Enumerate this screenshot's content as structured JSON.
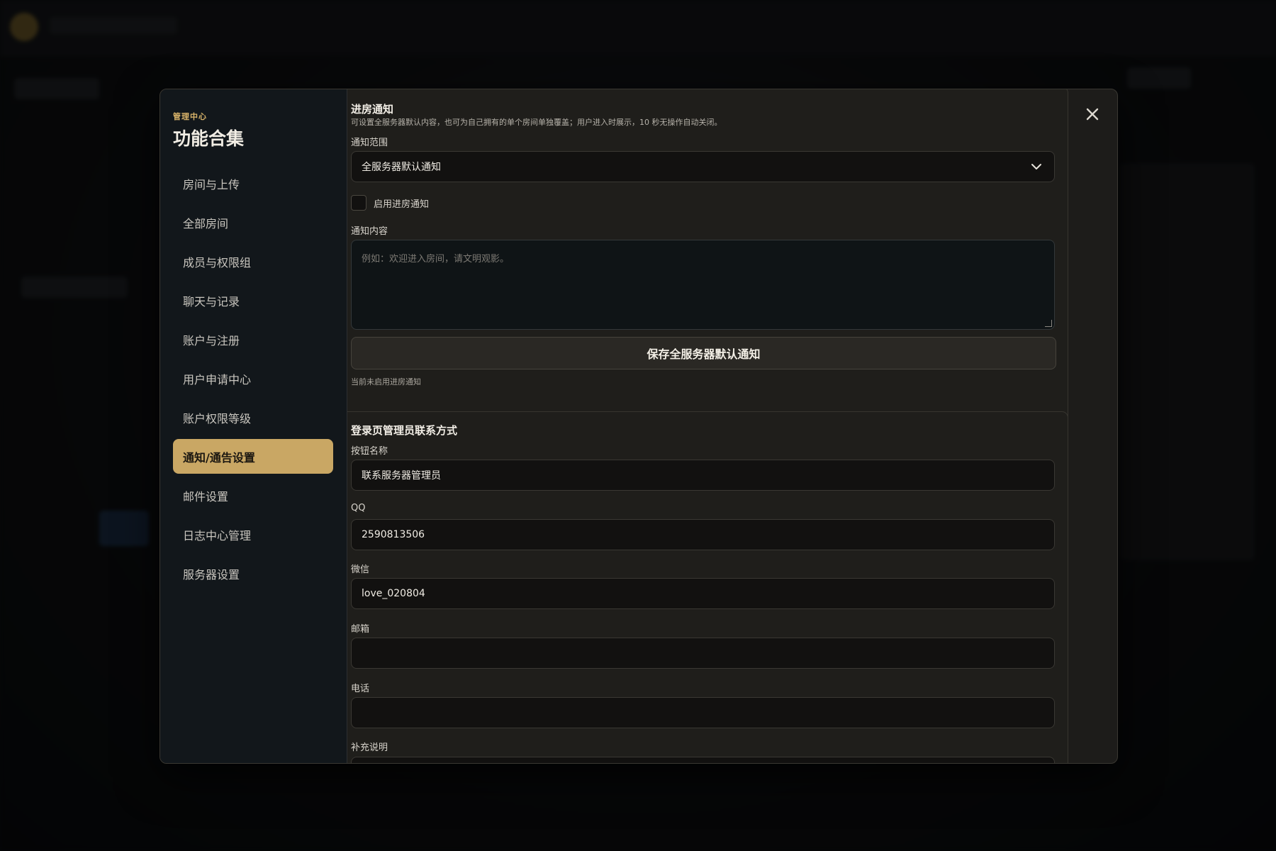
{
  "sidebar": {
    "eyebrow": "管理中心",
    "title": "功能合集",
    "items": [
      {
        "label": "房间与上传"
      },
      {
        "label": "全部房间"
      },
      {
        "label": "成员与权限组"
      },
      {
        "label": "聊天与记录"
      },
      {
        "label": "账户与注册"
      },
      {
        "label": "用户申请中心"
      },
      {
        "label": "账户权限等级"
      },
      {
        "label": "通知/通告设置",
        "active": true
      },
      {
        "label": "邮件设置"
      },
      {
        "label": "日志中心管理"
      },
      {
        "label": "服务器设置"
      }
    ]
  },
  "entry_notice": {
    "title": "进房通知",
    "subtitle": "可设置全服务器默认内容，也可为自己拥有的单个房间单独覆盖；用户进入时展示，10 秒无操作自动关闭。",
    "scope_label": "通知范围",
    "scope_value": "全服务器默认通知",
    "enable_label": "启用进房通知",
    "enabled": false,
    "content_label": "通知内容",
    "content_placeholder": "例如：欢迎进入房间，请文明观影。",
    "save_label": "保存全服务器默认通知",
    "status_hint": "当前未启用进房通知"
  },
  "admin_contact": {
    "title": "登录页管理员联系方式",
    "button_name_label": "按钮名称",
    "button_name_value": "联系服务器管理员",
    "qq_label": "QQ",
    "qq_value": "2590813506",
    "wechat_label": "微信",
    "wechat_value": "love_020804",
    "email_label": "邮箱",
    "email_value": "",
    "phone_label": "电话",
    "phone_value": "",
    "note_label": "补充说明"
  },
  "colors": {
    "accent": "#c9a764",
    "modal_bg": "#1d1c1a",
    "sidebar_bg": "#12171b"
  }
}
